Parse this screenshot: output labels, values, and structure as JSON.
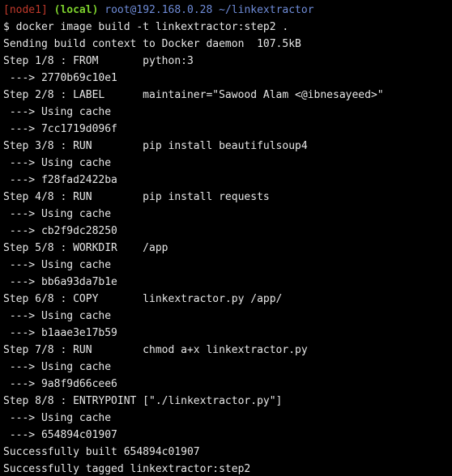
{
  "colors": {
    "background": "#000000",
    "text": "#e6e6e6",
    "node": "#c0392b",
    "local": "#7ccf2c",
    "user_host": "#6f8cd8"
  },
  "prompt": {
    "node": "[node1]",
    "local": "(local)",
    "user_host": "root@192.168.0.28",
    "path": "~/linkextractor"
  },
  "command": "$ docker image build -t linkextractor:step2 .",
  "output": [
    "Sending build context to Docker daemon  107.5kB",
    "Step 1/8 : FROM       python:3",
    " ---> 2770b69c10e1",
    "Step 2/8 : LABEL      maintainer=\"Sawood Alam <@ibnesayeed>\"",
    " ---> Using cache",
    " ---> 7cc1719d096f",
    "Step 3/8 : RUN        pip install beautifulsoup4",
    " ---> Using cache",
    " ---> f28fad2422ba",
    "Step 4/8 : RUN        pip install requests",
    " ---> Using cache",
    " ---> cb2f9dc28250",
    "Step 5/8 : WORKDIR    /app",
    " ---> Using cache",
    " ---> bb6a93da7b1e",
    "Step 6/8 : COPY       linkextractor.py /app/",
    " ---> Using cache",
    " ---> b1aae3e17b59",
    "Step 7/8 : RUN        chmod a+x linkextractor.py",
    " ---> Using cache",
    " ---> 9a8f9d66cee6",
    "Step 8/8 : ENTRYPOINT [\"./linkextractor.py\"]",
    " ---> Using cache",
    " ---> 654894c01907",
    "Successfully built 654894c01907",
    "Successfully tagged linkextractor:step2"
  ]
}
